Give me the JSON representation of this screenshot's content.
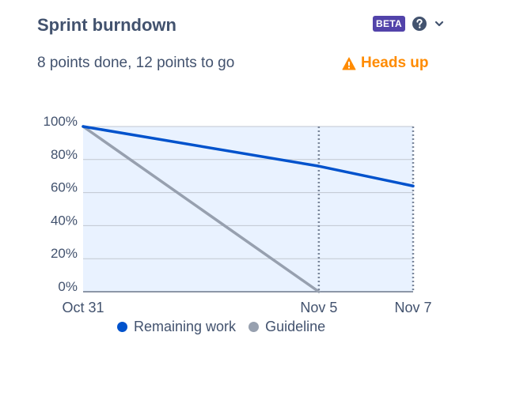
{
  "header": {
    "title": "Sprint burndown",
    "badge": "BETA",
    "help_icon": "question-circle-icon",
    "menu_icon": "chevron-down-icon"
  },
  "summary": {
    "text": "8 points done, 12 points to go",
    "warning": "Heads up",
    "warning_icon": "warning-triangle-icon"
  },
  "colors": {
    "remaining": "#0052cc",
    "guideline": "#97a0af",
    "area_fill": "#e9f2ff",
    "warning": "#ff8b00",
    "badge": "#5243aa"
  },
  "chart_data": {
    "type": "line",
    "title": "",
    "xlabel": "",
    "ylabel": "",
    "x_ticks": [
      "Oct 31",
      "Nov 5",
      "Nov 7"
    ],
    "y_ticks": [
      "100%",
      "80%",
      "60%",
      "40%",
      "20%",
      "0%"
    ],
    "ylim": [
      0,
      100
    ],
    "x_range_days": [
      0,
      7
    ],
    "markers": [
      5,
      7
    ],
    "series": [
      {
        "name": "Remaining work",
        "x": [
          0,
          5,
          7
        ],
        "y": [
          100,
          76,
          64
        ]
      },
      {
        "name": "Guideline",
        "x": [
          0,
          5
        ],
        "y": [
          100,
          0
        ]
      }
    ],
    "legend": [
      "Remaining work",
      "Guideline"
    ],
    "legend_position": "bottom",
    "grid": true
  }
}
